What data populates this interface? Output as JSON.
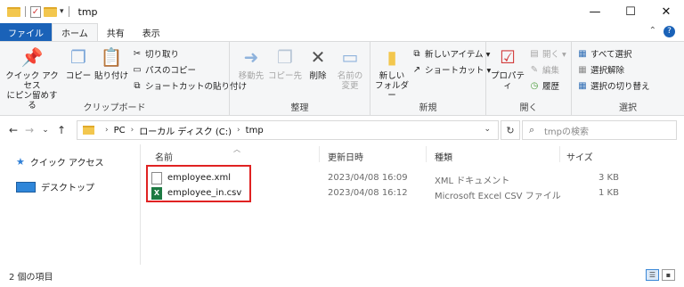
{
  "window": {
    "title": "tmp",
    "controls": {
      "minimize": "—",
      "maximize": "☐",
      "close": "✕"
    }
  },
  "tabs": [
    {
      "label": "ファイル"
    },
    {
      "label": "ホーム"
    },
    {
      "label": "共有"
    },
    {
      "label": "表示"
    }
  ],
  "ribbon": {
    "clipboard": {
      "label": "クリップボード",
      "pin_label": "クイック アクセス\nにピン留めする",
      "copy": "コピー",
      "paste": "貼り付け",
      "cut": "切り取り",
      "copy_path": "パスのコピー",
      "paste_shortcut": "ショートカットの貼り付け"
    },
    "organize": {
      "label": "整理",
      "move_to": "移動先",
      "copy_to": "コピー先",
      "delete": "削除",
      "rename": "名前の\n変更"
    },
    "new": {
      "label": "新規",
      "new_folder": "新しい\nフォルダー",
      "new_item": "新しいアイテム ▾",
      "shortcut": "ショートカット ▾"
    },
    "open": {
      "label": "開く",
      "properties": "プロパティ",
      "open": "開く ▾",
      "edit": "編集",
      "history": "履歴"
    },
    "select": {
      "label": "選択",
      "select_all": "すべて選択",
      "select_none": "選択解除",
      "invert": "選択の切り替え"
    }
  },
  "address": {
    "segments": [
      "PC",
      "ローカル ディスク (C:)",
      "tmp"
    ],
    "search_placeholder": "tmpの検索"
  },
  "sidebar": {
    "items": [
      {
        "label": "クイック アクセス"
      },
      {
        "label": "デスクトップ"
      }
    ]
  },
  "columns": {
    "name": "名前",
    "date": "更新日時",
    "type": "種類",
    "size": "サイズ"
  },
  "files": [
    {
      "name": "employee.xml",
      "date": "2023/04/08 16:09",
      "type": "XML ドキュメント",
      "size": "3 KB",
      "icon": "xml-file-icon"
    },
    {
      "name": "employee_in.csv",
      "date": "2023/04/08 16:12",
      "type": "Microsoft Excel CSV ファイル",
      "size": "1 KB",
      "icon": "excel-csv-icon"
    }
  ],
  "status": {
    "count": "2 個の項目"
  },
  "colors": {
    "accent": "#1a62b8",
    "highlight": "#e02222",
    "folder": "#f3c74e"
  }
}
